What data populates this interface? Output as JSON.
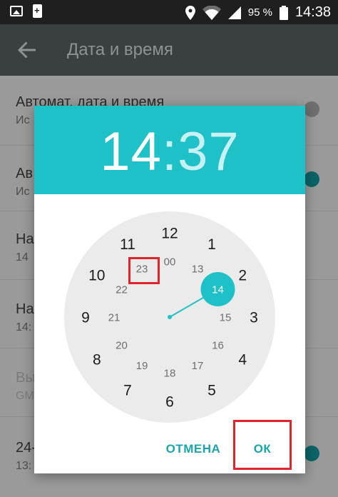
{
  "status_bar": {
    "battery_percent": "95 %",
    "time": "14:38",
    "icons": [
      "image-icon",
      "battery-saver-icon",
      "location-icon",
      "wifi-icon",
      "signal-icon",
      "battery-icon"
    ]
  },
  "app_bar": {
    "title": "Дата и время"
  },
  "settings": {
    "rows": [
      {
        "title": "Автомат. дата и время",
        "subtitle": "Ис",
        "switch": "off"
      },
      {
        "title": "Ав",
        "subtitle": "Ис",
        "switch": "on"
      },
      {
        "title": "На",
        "subtitle": "14",
        "switch": "none"
      },
      {
        "title": "На",
        "subtitle": "14:",
        "switch": "none"
      },
      {
        "title": "Вы",
        "subtitle": "GM",
        "switch": "none"
      },
      {
        "title": "24-",
        "subtitle": "13:",
        "switch": "on"
      }
    ]
  },
  "dialog": {
    "hours": "14",
    "colon": ":",
    "minutes": "37",
    "clock": {
      "selected": "14",
      "outer": [
        "12",
        "1",
        "2",
        "3",
        "4",
        "5",
        "6",
        "7",
        "8",
        "9",
        "10",
        "11"
      ],
      "inner": [
        "00",
        "13",
        "14",
        "15",
        "16",
        "17",
        "18",
        "19",
        "20",
        "21",
        "22",
        "23"
      ]
    },
    "cancel_label": "ОТМЕНА",
    "ok_label": "ОК"
  },
  "colors": {
    "accent": "#1ec1c8",
    "accent_text": "#1aa5ad",
    "highlight_box": "#e0242c"
  }
}
